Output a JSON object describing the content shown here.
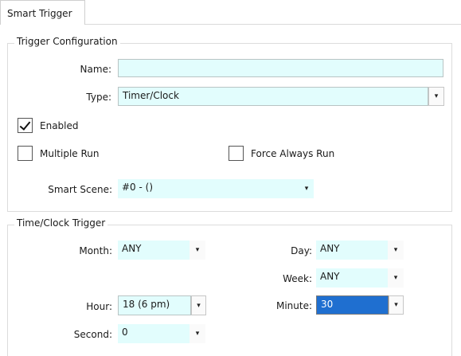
{
  "tab": {
    "label": "Smart Trigger"
  },
  "trigger_config": {
    "legend": "Trigger Configuration",
    "name_label": "Name:",
    "name_value": "",
    "type_label": "Type:",
    "type_value": "Timer/Clock",
    "enabled_label": "Enabled",
    "enabled_checked": true,
    "multiple_run_label": "Multiple Run",
    "multiple_run_checked": false,
    "force_always_run_label": "Force Always Run",
    "force_always_run_checked": false,
    "smart_scene_label": "Smart Scene:",
    "smart_scene_value": "#0 - ()"
  },
  "time_clock": {
    "legend": "Time/Clock Trigger",
    "month_label": "Month:",
    "month_value": "ANY",
    "day_label": "Day:",
    "day_value": "ANY",
    "week_label": "Week:",
    "week_value": "ANY",
    "hour_label": "Hour:",
    "hour_value": "18 (6 pm)",
    "minute_label": "Minute:",
    "minute_value": "30",
    "second_label": "Second:",
    "second_value": "0"
  },
  "icons": {
    "dropdown_arrow": "▾"
  },
  "colors": {
    "field_bg": "#e2fdfd",
    "selection_bg": "#1f6fd0"
  }
}
